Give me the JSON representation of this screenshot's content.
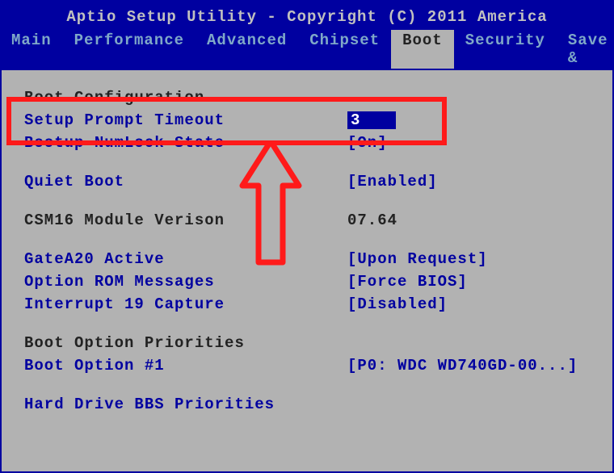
{
  "header": {
    "title": "Aptio Setup Utility - Copyright (C) 2011 America",
    "tabs": [
      {
        "label": "Main"
      },
      {
        "label": "Performance"
      },
      {
        "label": "Advanced"
      },
      {
        "label": "Chipset"
      },
      {
        "label": "Boot"
      },
      {
        "label": "Security"
      },
      {
        "label": "Save & "
      }
    ],
    "active_tab": "Boot"
  },
  "content": {
    "sections": [
      {
        "heading": "Boot Configuration",
        "rows": [
          {
            "label": "Setup Prompt Timeout",
            "value": "3",
            "type": "highlight"
          },
          {
            "label": "Bootup NumLock State",
            "value": "[On]",
            "type": "opt"
          }
        ]
      },
      {
        "rows": [
          {
            "label": "Quiet Boot",
            "value": "[Enabled]",
            "type": "opt"
          }
        ]
      },
      {
        "rows": [
          {
            "label": "CSM16 Module Verison",
            "value": "07.64",
            "type": "readonly"
          }
        ]
      },
      {
        "rows": [
          {
            "label": "GateA20 Active",
            "value": "[Upon Request]",
            "type": "opt"
          },
          {
            "label": "Option ROM Messages",
            "value": "[Force BIOS]",
            "type": "opt"
          },
          {
            "label": "Interrupt 19 Capture",
            "value": "[Disabled]",
            "type": "opt"
          }
        ]
      },
      {
        "heading": "Boot Option Priorities",
        "rows": [
          {
            "label": "Boot Option #1",
            "value": "[P0: WDC WD740GD-00...]",
            "type": "opt"
          }
        ]
      },
      {
        "rows": [
          {
            "label": "Hard Drive BBS Priorities",
            "value": "",
            "type": "opt"
          }
        ]
      }
    ]
  },
  "annotation": {
    "highlight_target": "Bootup NumLock State"
  }
}
